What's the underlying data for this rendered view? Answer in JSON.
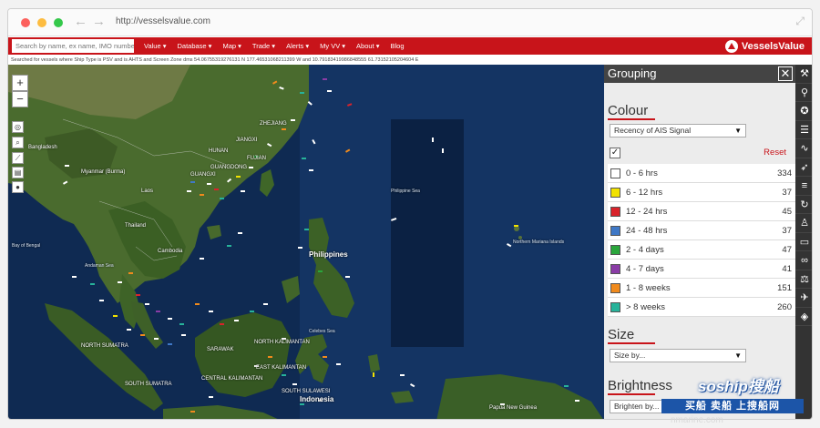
{
  "browser": {
    "url": "http://vesselsvalue.com"
  },
  "nav": {
    "search_placeholder": "Search by name, ex name, IMO number, com",
    "menu": [
      "Value ▾",
      "Database ▾",
      "Map ▾",
      "Trade ▾",
      "Alerts ▾",
      "My VV ▾",
      "About ▾",
      "Blog"
    ],
    "brand": "VesselsValue"
  },
  "search_info": "Searched for vessels where Ship Type is PSV and is AHTS and Screen Zone dms 54.06755319276131 N 177.46531068211399 W and 10.79183419986848555 61.73152105204604 E",
  "map": {
    "labels": [
      "Philippines",
      "Indonesia",
      "Cambodia",
      "Thailand",
      "Laos",
      "Myanmar (Burma)",
      "Bangladesh",
      "Philippine Sea",
      "NORTH SUMATRA",
      "SARAWAK",
      "NORTH KALIMANTAN",
      "EAST KALIMANTAN",
      "CENTRAL KALIMANTAN",
      "SOUTH SULAWESI",
      "SOUTH SUMATRA",
      "Papua New Guinea",
      "Celebes Sea",
      "Bay of Bengal",
      "Andaman Sea",
      "GUANGXI",
      "HUNAN",
      "JIANGXI",
      "FUJIAN",
      "ZHEJIANG",
      "GUANGDONG",
      "Northern Mariana Islands"
    ],
    "zoom_in": "+",
    "zoom_out": "−"
  },
  "panel": {
    "title": "Grouping",
    "close": "✕",
    "colour_title": "Colour",
    "colour_select": "Recency of AIS Signal",
    "checkbox_mark": "✓",
    "reset": "Reset",
    "legend": [
      {
        "label": "0 - 6 hrs",
        "count": "334",
        "color": "#ffffff"
      },
      {
        "label": "6 - 12 hrs",
        "count": "37",
        "color": "#f2e200"
      },
      {
        "label": "12 - 24 hrs",
        "count": "45",
        "color": "#d9232b"
      },
      {
        "label": "24 - 48 hrs",
        "count": "37",
        "color": "#3f78c6"
      },
      {
        "label": "2 - 4 days",
        "count": "47",
        "color": "#2aa63c"
      },
      {
        "label": "4 - 7 days",
        "count": "41",
        "color": "#8a3ca6"
      },
      {
        "label": "1 - 8 weeks",
        "count": "151",
        "color": "#f08a1c"
      },
      {
        "label": "> 8 weeks",
        "count": "260",
        "color": "#27b39a"
      }
    ],
    "size_title": "Size",
    "size_select": "Size by...",
    "brightness_title": "Brightness",
    "brightness_select": "Brighten by..."
  },
  "toolbar_icons": [
    "wrench-icon",
    "magnifier-icon",
    "compass-icon",
    "layers-icon",
    "route-icon",
    "rocket-icon",
    "list-icon",
    "refresh-icon",
    "person-icon",
    "document-icon",
    "link-icon",
    "scale-icon",
    "plane-icon",
    "fish-icon"
  ],
  "watermark": {
    "top": "soship搜船",
    "bottom": "买船 卖船 上搜船网",
    "faint": "nmarine.com"
  },
  "colors": {
    "brand_red": "#c8141a",
    "panel_header": "#444444",
    "toolbar": "#333333"
  }
}
